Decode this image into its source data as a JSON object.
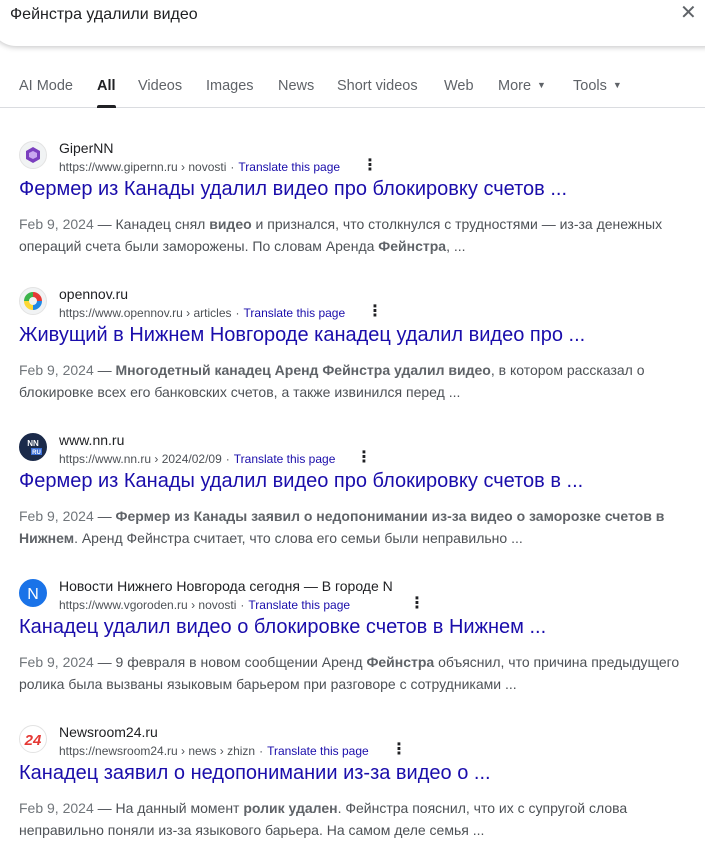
{
  "search": {
    "query": "Фейнстра удалили видео",
    "clear_icon": "close-icon"
  },
  "tabs": [
    {
      "label": "AI Mode"
    },
    {
      "label": "All"
    },
    {
      "label": "Videos"
    },
    {
      "label": "Images"
    },
    {
      "label": "News"
    },
    {
      "label": "Short videos"
    },
    {
      "label": "Web"
    },
    {
      "label": "More"
    },
    {
      "label": "Tools"
    }
  ],
  "translate_label": "Translate this page",
  "results": [
    {
      "site": "GiperNN",
      "url": "https://www.gipernn.ru › novosti",
      "title": "Фермер из Канады удалил видео про блокировку счетов ...",
      "date": "Feb 9, 2024",
      "snippet_parts": [
        {
          "t": " — Канадец снял "
        },
        {
          "b": "видео"
        },
        {
          "t": " и признался, что столкнулся с трудностями — из-за денежных операций счета были заморожены. По словам Аренда "
        },
        {
          "b": "Фейнстра"
        },
        {
          "t": ", ..."
        }
      ],
      "favicon": "gipernn-logo-icon",
      "favicon_color": "#7b3fbf"
    },
    {
      "site": "opennov.ru",
      "url": "https://www.opennov.ru › articles",
      "title": "Живущий в Нижнем Новгороде канадец удалил видео про ...",
      "date": "Feb 9, 2024",
      "snippet_parts": [
        {
          "t": " — "
        },
        {
          "b": "Многодетный канадец Аренд Фейнстра удалил видео"
        },
        {
          "t": ", в котором рассказал о блокировке всех его банковских счетов, а также извинился перед ..."
        }
      ],
      "favicon": "opennov-logo-icon",
      "favicon_color": "#3cb44b"
    },
    {
      "site": "www.nn.ru",
      "url": "https://www.nn.ru › 2024/02/09",
      "title": "Фермер из Канады удалил видео про блокировку счетов в ...",
      "date": "Feb 9, 2024",
      "snippet_parts": [
        {
          "t": " — "
        },
        {
          "b": "Фермер из Канады заявил о недопонимании из-за видео о заморозке счетов в Нижнем"
        },
        {
          "t": ". Аренд Фейнстра считает, что слова его семьи были неправильно ..."
        }
      ],
      "favicon": "nn-logo-icon",
      "favicon_color": "#1b2a4a",
      "favicon_text": "NN\nRU"
    },
    {
      "site": "Новости Нижнего Новгорода сегодня — В городе N",
      "url": "https://www.vgoroden.ru › novosti",
      "title": "Канадец удалил видео о блокировке счетов в Нижнем ...",
      "date": "Feb 9, 2024",
      "snippet_parts": [
        {
          "t": " — 9 февраля в новом сообщении Аренд "
        },
        {
          "b": "Фейнстра"
        },
        {
          "t": " объяснил, что причина предыдущего ролика была вызваны языковым барьером при разговоре с сотрудниками ..."
        }
      ],
      "favicon": "vgoroden-logo-icon",
      "favicon_color": "#1a73e8",
      "favicon_text": "N"
    },
    {
      "site": "Newsroom24.ru",
      "url": "https://newsroom24.ru › news › zhizn",
      "title": "Канадец заявил о недопонимании из-за видео о ...",
      "date": "Feb 9, 2024",
      "snippet_parts": [
        {
          "t": " — На данный момент "
        },
        {
          "b": "ролик удален"
        },
        {
          "t": ". Фейнстра пояснил, что их с супругой слова неправильно поняли из-за языкового барьера. На самом деле семья ..."
        }
      ],
      "favicon": "newsroom24-logo-icon",
      "favicon_color": "#e53935",
      "favicon_text": "24"
    }
  ]
}
